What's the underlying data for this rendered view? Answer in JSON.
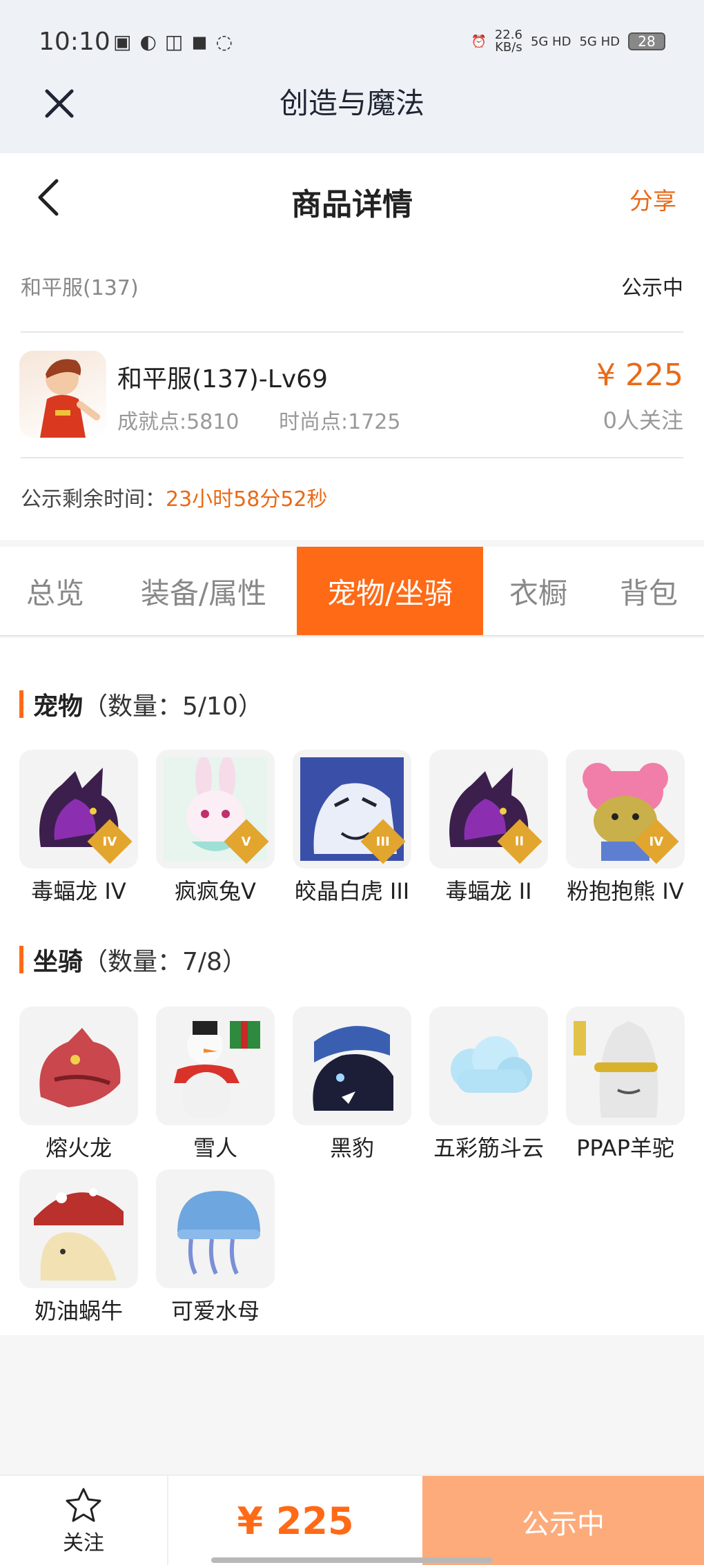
{
  "status_bar": {
    "time": "10:10",
    "speed_top": "22.6",
    "speed_unit": "KB/s",
    "net1": "5G HD",
    "net2": "5G HD",
    "battery": "28"
  },
  "app": {
    "title": "创造与魔法"
  },
  "nav": {
    "title": "商品详情",
    "share": "分享"
  },
  "listing": {
    "server": "和平服(137)",
    "state": "公示中",
    "name": "和平服(137)-Lv69",
    "achievement": "成就点:5810",
    "fashion": "时尚点:1725",
    "price": "¥ 225",
    "followers": "0人关注",
    "remain_label": "公示剩余时间：",
    "remain_value": "23小时58分52秒"
  },
  "tabs": [
    "总览",
    "装备/属性",
    "宠物/坐骑",
    "衣橱",
    "背包"
  ],
  "active_tab": 2,
  "pets": {
    "title": "宠物",
    "count": "（数量：5/10）",
    "items": [
      {
        "label": "毒蝠龙 IV",
        "badge": "IV",
        "icon": "bat-dragon-icon",
        "color": "#5b2a7a"
      },
      {
        "label": "疯疯兔V",
        "badge": "V",
        "icon": "rabbit-icon",
        "color": "#f2d6e8"
      },
      {
        "label": "皎晶白虎 III",
        "badge": "III",
        "icon": "white-tiger-icon",
        "color": "#4d64b8"
      },
      {
        "label": "毒蝠龙 II",
        "badge": "II",
        "icon": "bat-dragon-icon",
        "color": "#5b2a7a"
      },
      {
        "label": "粉抱抱熊 IV",
        "badge": "IV",
        "icon": "pink-bear-icon",
        "color": "#f08fb5"
      }
    ]
  },
  "mounts": {
    "title": "坐骑",
    "count": "（数量：7/8）",
    "items": [
      {
        "label": "熔火龙",
        "icon": "fire-dragon-icon",
        "color": "#c9474d"
      },
      {
        "label": "雪人",
        "icon": "snowman-icon",
        "color": "#e9e9e9"
      },
      {
        "label": "黑豹",
        "icon": "black-panther-icon",
        "color": "#2b2f55"
      },
      {
        "label": "五彩筋斗云",
        "icon": "cloud-icon",
        "color": "#aee0f5"
      },
      {
        "label": "PPAP羊驼",
        "icon": "alpaca-icon",
        "color": "#dcdcdc"
      },
      {
        "label": "奶油蜗牛",
        "icon": "snail-icon",
        "color": "#e8d7a8"
      },
      {
        "label": "可爱水母",
        "icon": "jellyfish-icon",
        "color": "#7fb2e6"
      }
    ]
  },
  "bottom": {
    "follow_label": "关注",
    "price": "¥ 225",
    "state": "公示中"
  },
  "colors": {
    "accent": "#ff6a16",
    "price": "#e86a17",
    "badge": "#e2a52e"
  }
}
